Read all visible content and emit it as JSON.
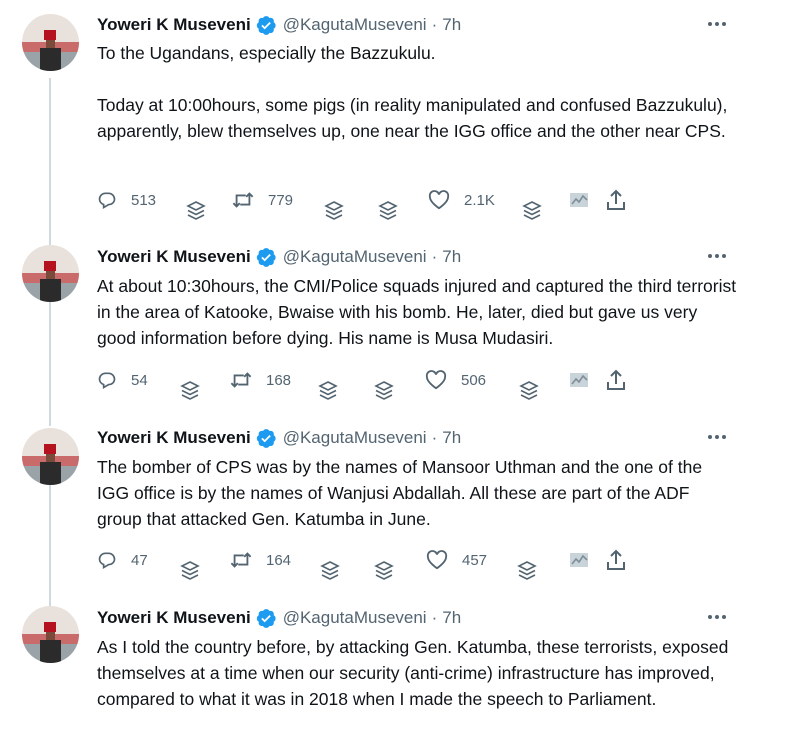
{
  "tweets": [
    {
      "author": "Yoweri K Museveni",
      "handle": "@KagutaMuseveni",
      "separator": "·",
      "time": "7h",
      "paragraphs": [
        "To the Ugandans, especially the Bazzukulu.",
        "Today at 10:00hours, some pigs (in reality manipulated and confused Bazzukulu), apparently, blew themselves up, one near the IGG office and the other near CPS."
      ],
      "replies": "513",
      "retweets": "779",
      "likes": "2.1K"
    },
    {
      "author": "Yoweri K Museveni",
      "handle": "@KagutaMuseveni",
      "separator": "·",
      "time": "7h",
      "paragraphs": [
        "At about 10:30hours, the CMI/Police squads injured and captured the third terrorist in the area of Katooke, Bwaise with his bomb. He, later, died but gave us very good information before dying. His name is Musa Mudasiri."
      ],
      "replies": "54",
      "retweets": "168",
      "likes": "506"
    },
    {
      "author": "Yoweri K Museveni",
      "handle": "@KagutaMuseveni",
      "separator": "·",
      "time": "7h",
      "paragraphs": [
        "The bomber of CPS was by the names of Mansoor Uthman and the one of the IGG office is by the names of Wanjusi Abdallah. All these are part of the ADF group that attacked Gen. Katumba in June."
      ],
      "replies": "47",
      "retweets": "164",
      "likes": "457"
    },
    {
      "author": "Yoweri K Museveni",
      "handle": "@KagutaMuseveni",
      "separator": "·",
      "time": "7h",
      "paragraphs": [
        "As I told the country before, by attacking Gen. Katumba, these terrorists, exposed themselves at a time when our security (anti-crime) infrastructure has improved, compared to what it was in 2018 when I made the speech to Parliament."
      ]
    }
  ],
  "colors": {
    "text": "#0f1419",
    "secondary": "#536471",
    "verified": "#1d9bf0",
    "thread_line": "#cfd9de"
  },
  "icons": {
    "verified": "verified-badge-icon",
    "more": "more-dots-icon",
    "reply": "reply-icon",
    "retweet": "retweet-icon",
    "like": "heart-icon",
    "analytics": "analytics-icon",
    "share": "share-icon",
    "stack": "layers-icon"
  }
}
